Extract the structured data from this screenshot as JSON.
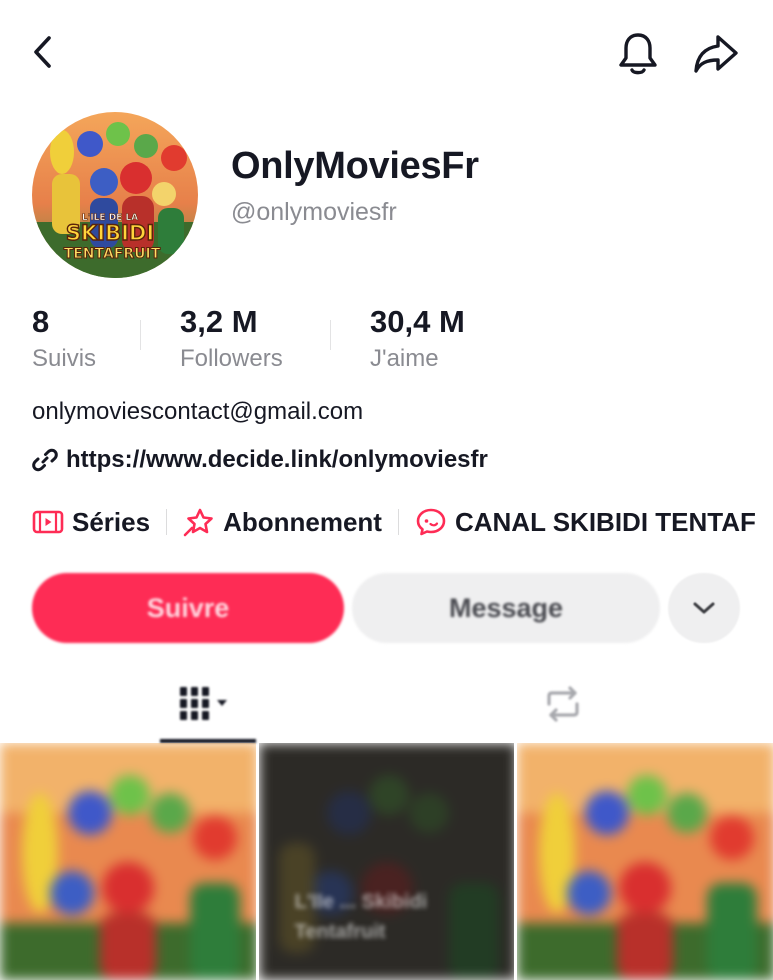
{
  "header": {
    "back_icon": "chevron-left-icon",
    "bell_icon": "bell-icon",
    "share_icon": "share-arrow-icon"
  },
  "profile": {
    "avatar_text": [
      "L'ILE DE LA",
      "SKIBIDI",
      "TENTAFRUIT"
    ],
    "display_name": "OnlyMoviesFr",
    "username": "@onlymoviesfr"
  },
  "stats": [
    {
      "value": "8",
      "label": "Suivis"
    },
    {
      "value": "3,2 M",
      "label": "Followers"
    },
    {
      "value": "30,4 M",
      "label": "J'aime"
    }
  ],
  "bio": {
    "email": "onlymoviescontact@gmail.com",
    "link_icon": "link-icon",
    "link": "https://www.decide.link/onlymoviesfr"
  },
  "chips": [
    {
      "icon": "series-icon",
      "label": "Séries"
    },
    {
      "icon": "subscription-star-icon",
      "label": "Abonnement"
    },
    {
      "icon": "chat-bubble-icon",
      "label": "CANAL SKIBIDI TENTAF"
    }
  ],
  "actions": {
    "follow_label": "Suivre",
    "message_label": "Message",
    "more_icon": "chevron-down-icon"
  },
  "tabs": [
    {
      "icon": "grid-icon",
      "active": true
    },
    {
      "icon": "repost-icon",
      "active": false
    }
  ],
  "videos": [
    {
      "caption": ""
    },
    {
      "caption": "L'IIe ... Skibidi",
      "caption_line2": "Tentafruit"
    },
    {
      "caption": ""
    }
  ],
  "colors": {
    "accent": "#fe2c55",
    "text": "#161823",
    "muted": "#8a8b91",
    "button_gray": "#efeff0"
  }
}
